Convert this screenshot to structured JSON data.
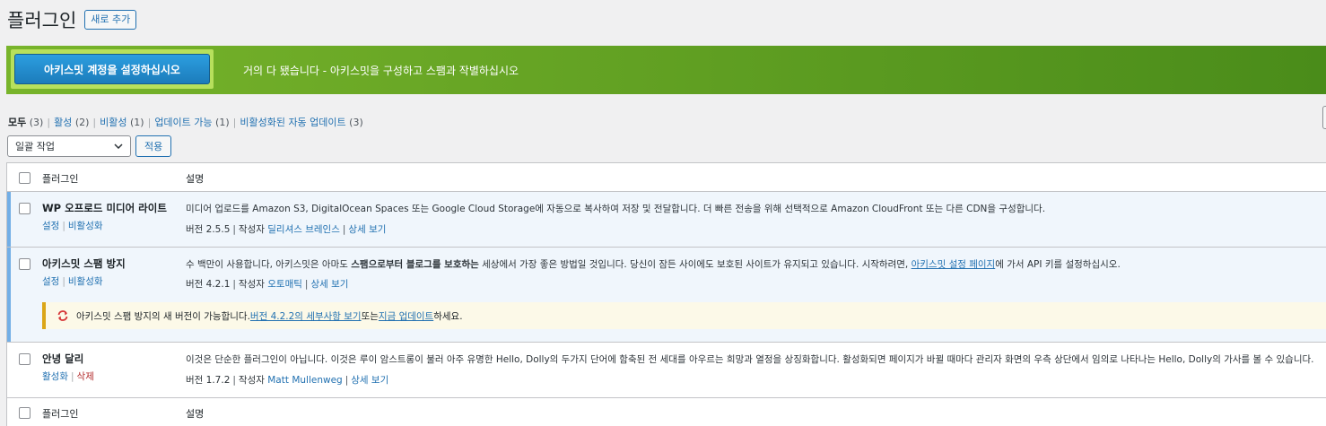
{
  "header": {
    "title": "플러그인",
    "add_new": "새로 추가"
  },
  "banner": {
    "button": "아키스밋 계정을 설정하십시오",
    "text": "거의 다 됐습니다 - 아키스밋을 구성하고 스팸과 작별하십시오"
  },
  "filters": {
    "all": "모두",
    "all_count": "(3)",
    "active": "활성",
    "active_count": "(2)",
    "inactive": "비활성",
    "inactive_count": "(1)",
    "update": "업데이트 가능",
    "update_count": "(1)",
    "auto": "비활성화된 자동 업데이트",
    "auto_count": "(3)"
  },
  "bulk": {
    "select": "일괄 작업",
    "apply": "적용"
  },
  "table": {
    "col_plugin": "플러그인",
    "col_desc": "설명"
  },
  "plugins": [
    {
      "name": "WP 오프로드 미디어 라이트",
      "action1": "설정",
      "action2": "비활성화",
      "desc": "미디어 업로드를 Amazon S3, DigitalOcean Spaces 또는 Google Cloud Storage에 자동으로 복사하여 저장 및 전달합니다. 더 빠른 전송을 위해 선택적으로 Amazon CloudFront 또는 다른 CDN을 구성합니다.",
      "version": "버전 2.5.5",
      "by": "작성자",
      "author": "딜리셔스 브레인스",
      "details": "상세 보기"
    },
    {
      "name": "아키스밋 스팸 방지",
      "action1": "설정",
      "action2": "비활성화",
      "desc_a": "수 백만이 사용합니다, 아키스밋은 아마도 ",
      "desc_b": "스팸으로부터 블로그를 보호하는",
      "desc_c": " 세상에서 가장 좋은 방법일 것입니다. 당신이 잠든 사이에도 보호된 사이트가 유지되고 있습니다. 시작하려면, ",
      "desc_link": "아키스밋 설정 페이지",
      "desc_d": "에 가서 API 키를 설정하십시오.",
      "version": "버전 4.2.1",
      "by": "작성자",
      "author": "오토매틱",
      "details": "상세 보기",
      "notice_a": "아키스밋 스팸 방지의 새 버전이 가능합니다. ",
      "notice_link1": "버전 4.2.2의 세부사항 보기",
      "notice_b": " 또는 ",
      "notice_link2": "지금 업데이트",
      "notice_c": "하세요."
    },
    {
      "name": "안녕 달리",
      "action1": "활성화",
      "action2": "삭제",
      "desc": "이것은 단순한 플러그인이 아닙니다. 이것은 루이 암스트롱이 불러 아주 유명한 Hello, Dolly의 두가지 단어에 함축된 전 세대를 아우르는 희망과 열정을 상징화합니다. 활성화되면 페이지가 바뀔 때마다 관리자 화면의 우측 상단에서 임의로 나타나는 Hello, Dolly의 가사를 볼 수 있습니다.",
      "version": "버전 1.7.2",
      "by": "작성자",
      "author": "Matt Mullenweg",
      "details": "상세 보기"
    }
  ]
}
